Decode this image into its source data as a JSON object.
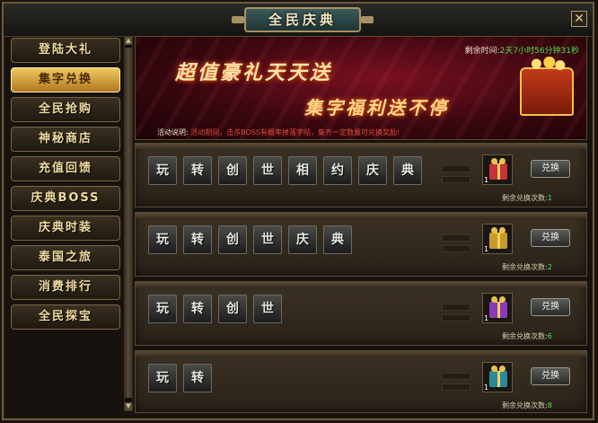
{
  "window": {
    "title": "全民庆典",
    "close_label": "✕"
  },
  "sidebar": {
    "items": [
      {
        "label": "登陆大礼",
        "active": false
      },
      {
        "label": "集字兑换",
        "active": true
      },
      {
        "label": "全民抢购",
        "active": false
      },
      {
        "label": "神秘商店",
        "active": false
      },
      {
        "label": "充值回馈",
        "active": false
      },
      {
        "label": "庆典BOSS",
        "active": false
      },
      {
        "label": "庆典时装",
        "active": false
      },
      {
        "label": "泰国之旅",
        "active": false
      },
      {
        "label": "消费排行",
        "active": false
      },
      {
        "label": "全民探宝",
        "active": false
      }
    ]
  },
  "scrollbar": {
    "up_glyph": "▲",
    "down_glyph": "▼"
  },
  "banner": {
    "remaining_label": "剩余时间:",
    "remaining_value": "2天7小时56分钟31秒",
    "slogan_line1": "超值豪礼天天送",
    "slogan_line2": "集字福利送不停",
    "desc_label": "活动说明:",
    "desc_text": "活动期间，击杀BOSS有概率掉落字帖，集齐一定数量可兑换奖励!"
  },
  "rows": [
    {
      "chars": [
        "玩",
        "转",
        "创",
        "世",
        "相",
        "约",
        "庆",
        "典"
      ],
      "gift_color": "#c8323a",
      "gift_qty": "1",
      "button_label": "兑换",
      "remain_label": "剩余兑换次数:",
      "remain_value": "1"
    },
    {
      "chars": [
        "玩",
        "转",
        "创",
        "世",
        "庆",
        "典"
      ],
      "gift_color": "#c89a2a",
      "gift_qty": "1",
      "button_label": "兑换",
      "remain_label": "剩余兑换次数:",
      "remain_value": "2"
    },
    {
      "chars": [
        "玩",
        "转",
        "创",
        "世"
      ],
      "gift_color": "#8a3ab8",
      "gift_qty": "1",
      "button_label": "兑换",
      "remain_label": "剩余兑换次数:",
      "remain_value": "6"
    },
    {
      "chars": [
        "玩",
        "转"
      ],
      "gift_color": "#2a8a9a",
      "gift_qty": "1",
      "button_label": "兑换",
      "remain_label": "剩余兑换次数:",
      "remain_value": "8"
    }
  ]
}
